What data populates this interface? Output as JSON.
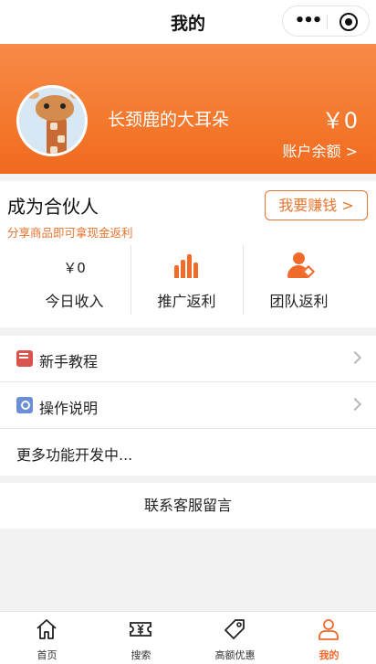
{
  "header": {
    "title": "我的"
  },
  "profile": {
    "username": "长颈鹿的大耳朵",
    "balance": "￥0",
    "balance_label": "账户余额 >"
  },
  "partner": {
    "title": "成为合伙人",
    "subtitle": "分享商品即可拿现金返利",
    "earn_button": "我要赚钱 >",
    "stats": [
      {
        "value": "￥0",
        "label": "今日收入"
      },
      {
        "icon": "bar-chart-icon",
        "label": "推广返利"
      },
      {
        "icon": "team-user-icon",
        "label": "团队返利"
      }
    ]
  },
  "menu": {
    "items": [
      {
        "icon": "book-icon",
        "label": "新手教程"
      },
      {
        "icon": "search-doc-icon",
        "label": "操作说明"
      },
      {
        "label": "更多功能开发中..."
      }
    ]
  },
  "contact": {
    "label": "联系客服留言"
  },
  "tabbar": {
    "tabs": [
      {
        "label": "首页",
        "icon": "home-icon"
      },
      {
        "label": "搜索",
        "icon": "coupon-icon"
      },
      {
        "label": "高额优惠",
        "icon": "tag-icon"
      },
      {
        "label": "我的",
        "icon": "user-icon"
      }
    ],
    "active_color": "#f06a2a"
  },
  "colors": {
    "accent": "#f47a2f",
    "accent_dark": "#f06a2a"
  }
}
